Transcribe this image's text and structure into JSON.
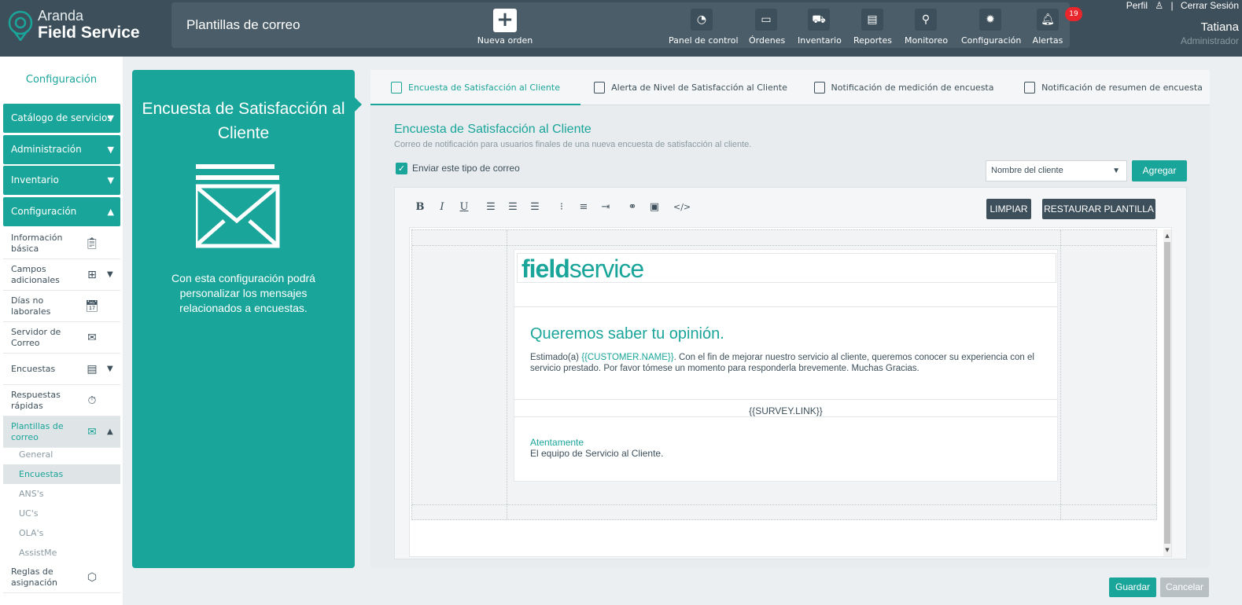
{
  "brand": {
    "line1": "Aranda",
    "line2": "Field Service"
  },
  "header": {
    "page_title": "Plantillas de correo",
    "new_order": "Nueva orden",
    "nav": [
      {
        "label": "Panel de control",
        "icon": "dashboard-icon"
      },
      {
        "label": "Órdenes",
        "icon": "orders-icon"
      },
      {
        "label": "Inventario",
        "icon": "inventory-icon"
      },
      {
        "label": "Reportes",
        "icon": "reports-icon"
      },
      {
        "label": "Monitoreo",
        "icon": "monitoring-icon"
      },
      {
        "label": "Configuración",
        "icon": "gear-icon"
      },
      {
        "label": "Alertas",
        "icon": "bell-icon",
        "badge": "19"
      }
    ]
  },
  "user": {
    "profile": "Perfil",
    "separator": "|",
    "logout": "Cerrar Sesión",
    "name": "Tatiana",
    "role": "Administrador"
  },
  "sidebar": {
    "title": "Configuración",
    "sections": [
      "Catálogo de servicios",
      "Administración",
      "Inventario",
      "Configuración"
    ],
    "items": [
      {
        "label": "Información básica",
        "icon": "clipboard-check-icon"
      },
      {
        "label": "Campos adicionales",
        "icon": "plus-box-icon"
      },
      {
        "label": "Días no laborales",
        "icon": "calendar-icon"
      },
      {
        "label": "Servidor de Correo",
        "icon": "mail-icon"
      },
      {
        "label": "Encuestas",
        "icon": "survey-icon"
      },
      {
        "label": "Respuestas rápidas",
        "icon": "stopwatch-icon"
      },
      {
        "label": "Plantillas de correo",
        "icon": "mail-template-icon"
      },
      {
        "label": "Reglas de asignación",
        "icon": "cube-icon"
      }
    ],
    "subitems": [
      "General",
      "Encuestas",
      "ANS's",
      "UC's",
      "OLA's",
      "AssistMe"
    ]
  },
  "info_panel": {
    "title": "Encuesta de Satisfacción al Cliente",
    "description": "Con esta configuración podrá personalizar los mensajes relacionados a encuestas."
  },
  "tabs": [
    "Encuesta de Satisfacción al Cliente",
    "Alerta de Nivel de Satisfacción al Cliente",
    "Notificación de medición de encuesta",
    "Notificación de resumen de encuesta"
  ],
  "main": {
    "title": "Encuesta de Satisfacción al Cliente",
    "description": "Correo de notificación para usuarios finales de una nueva encuesta de satisfacción al cliente.",
    "send_checkbox_label": "Enviar este tipo de correo",
    "send_checked": true,
    "field_select_value": "Nombre del cliente",
    "add_button": "Agregar",
    "clear_button": "LIMPIAR",
    "restore_button": "RESTAURAR PLANTILLA"
  },
  "email": {
    "logo_bold": "field",
    "logo_light": "service",
    "heading": "Queremos saber tu opinión.",
    "greeting": "Estimado(a) ",
    "customer_var": "{{CUSTOMER.NAME}}",
    "body": ". Con el fin de mejorar nuestro servicio al cliente, queremos conocer su experiencia con el servicio prestado. Por favor tómese un momento para responderla brevemente. Muchas Gracias.",
    "survey_link": "{{SURVEY.LINK}}",
    "closing": "Atentamente",
    "signature": "El equipo de Servicio al Cliente."
  },
  "footer": {
    "save": "Guardar",
    "cancel": "Cancelar"
  },
  "colors": {
    "accent": "#1aa59a",
    "topbar": "#3d4f5a",
    "badge": "#e8262b"
  }
}
